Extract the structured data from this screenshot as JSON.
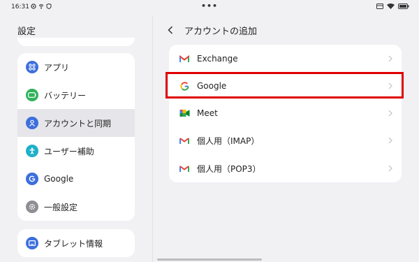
{
  "status_bar": {
    "time": "16:31",
    "center": "•••"
  },
  "left_pane": {
    "title": "設定",
    "items": [
      {
        "label": "アプリ",
        "icon": "apps-grid-icon",
        "color": "#3d6fdc"
      },
      {
        "label": "バッテリー",
        "icon": "battery-icon",
        "color": "#2fb25b"
      },
      {
        "label": "アカウントと同期",
        "icon": "account-person-icon",
        "color": "#3d6fdc",
        "selected": true
      },
      {
        "label": "ユーザー補助",
        "icon": "accessibility-icon",
        "color": "#1fb0c9"
      },
      {
        "label": "Google",
        "icon": "google-g-icon",
        "color": "#3d6fdc"
      },
      {
        "label": "一般設定",
        "icon": "gear-icon",
        "color": "#8e8e93"
      }
    ],
    "info": {
      "label": "タブレット情報",
      "icon": "tablet-info-icon",
      "color": "#3d6fdc"
    }
  },
  "right_pane": {
    "title": "アカウントの追加",
    "accounts": [
      {
        "label": "Exchange",
        "icon": "gmail-icon"
      },
      {
        "label": "Google",
        "icon": "google-g-icon"
      },
      {
        "label": "Meet",
        "icon": "meet-icon"
      },
      {
        "label": "個人用（IMAP）",
        "icon": "gmail-icon"
      },
      {
        "label": "個人用（POP3）",
        "icon": "gmail-icon"
      }
    ],
    "highlighted": "Google"
  }
}
